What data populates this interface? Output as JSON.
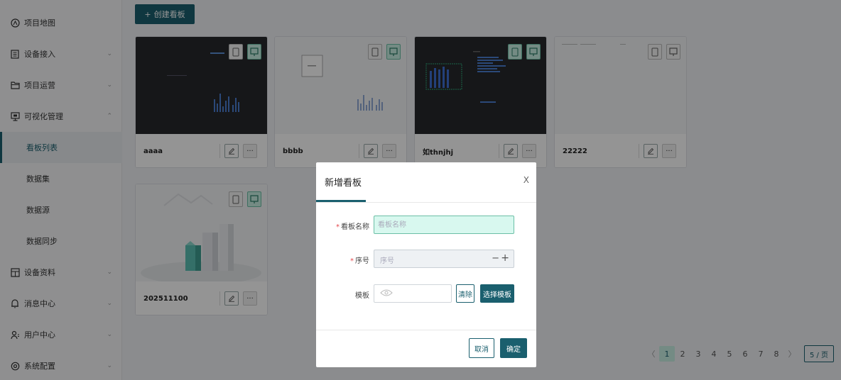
{
  "sidebar": {
    "items": [
      {
        "label": "项目地图",
        "icon": "map-icon",
        "chevron": ""
      },
      {
        "label": "设备接入",
        "icon": "device-icon",
        "chevron": "⌄"
      },
      {
        "label": "项目运营",
        "icon": "folder-icon",
        "chevron": "⌄"
      },
      {
        "label": "可视化管理",
        "icon": "monitor-icon",
        "chevron": "⌃"
      },
      {
        "label": "设备资料",
        "icon": "document-icon",
        "chevron": "⌄"
      },
      {
        "label": "消息中心",
        "icon": "bell-icon",
        "chevron": "⌄"
      },
      {
        "label": "用户中心",
        "icon": "users-icon",
        "chevron": "⌄"
      },
      {
        "label": "系统配置",
        "icon": "settings-icon",
        "chevron": "⌄"
      }
    ],
    "sub_items": [
      "看板列表",
      "数据集",
      "数据源",
      "数据同步"
    ]
  },
  "toolbar": {
    "create_label": "创建看板",
    "create_icon": "+"
  },
  "cards": [
    {
      "name": "aaaa",
      "theme": "dark"
    },
    {
      "name": "bbbb",
      "theme": "light"
    },
    {
      "name": "如thnjhj",
      "theme": "dark"
    },
    {
      "name": "22222",
      "theme": "light"
    },
    {
      "name": "202511100",
      "theme": "illustration"
    }
  ],
  "card_actions": {
    "more_label": "···"
  },
  "pagination": {
    "prev": "〈",
    "pages": [
      "1",
      "2",
      "3",
      "4",
      "5",
      "6",
      "7",
      "8"
    ],
    "current": "1",
    "next": "〉",
    "page_size": "5 / 页"
  },
  "dialog": {
    "title": "新增看板",
    "close": "X",
    "fields": {
      "name_label": "看板名称",
      "name_placeholder": "看板名称",
      "seq_label": "序号",
      "seq_placeholder": "序号",
      "template_label": "模板"
    },
    "required_mark": "*",
    "clear_label": "清除",
    "choose_label": "选择模板",
    "cancel_label": "取消",
    "ok_label": "确定"
  },
  "colors": {
    "primary": "#1a5f6e",
    "accent_light": "#c8efe3",
    "danger": "#e5484d"
  }
}
